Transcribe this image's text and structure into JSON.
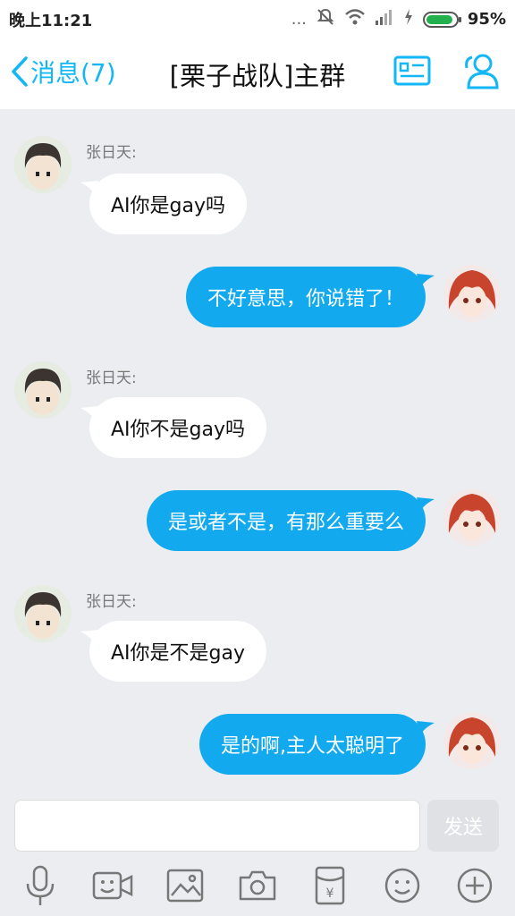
{
  "statusbar": {
    "time": "晚上11:21",
    "dots": "...",
    "battery_pct": "95%",
    "battery_level": 0.95,
    "icons": [
      "dots-icon",
      "mute-icon",
      "wifi-icon",
      "signal-icon",
      "charging-icon",
      "battery-icon"
    ]
  },
  "nav": {
    "back_label": "消息(7)",
    "title": "[栗子战队]主群",
    "accent": "#12b7f5",
    "icons": [
      "profile-card-icon",
      "group-members-icon"
    ]
  },
  "messages": [
    {
      "dir": "in",
      "sender": "张日天:",
      "text": "AI你是gay吗"
    },
    {
      "dir": "out",
      "text": "不好意思，你说错了！"
    },
    {
      "dir": "in",
      "sender": "张日天:",
      "text": "AI你不是gay吗"
    },
    {
      "dir": "out",
      "text": "是或者不是，有那么重要么"
    },
    {
      "dir": "in",
      "sender": "张日天:",
      "text": "AI你是不是gay"
    },
    {
      "dir": "out",
      "text": "是的啊,主人太聪明了"
    }
  ],
  "input": {
    "value": "",
    "placeholder": "",
    "send_label": "发送"
  },
  "toolbar": {
    "icons": [
      "microphone-icon",
      "video-call-icon",
      "image-icon",
      "camera-icon",
      "red-packet-icon",
      "emoji-icon",
      "plus-icon"
    ]
  },
  "colors": {
    "outgoing_bubble": "#12a9ef",
    "incoming_bubble": "#ffffff",
    "background": "#ebedf0"
  }
}
